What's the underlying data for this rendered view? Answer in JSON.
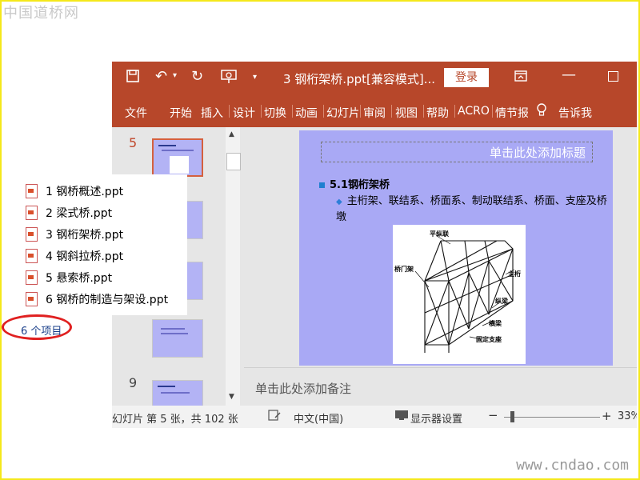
{
  "watermarks": {
    "top": "中国道桥网",
    "bottom": "www.cndao.com"
  },
  "window": {
    "title": "3 钢桁架桥.ppt[兼容模式]...",
    "login_label": "登录",
    "quick_access": {
      "save_icon": "save-icon",
      "undo_icon": "undo-icon",
      "redo_icon": "redo-icon",
      "present_icon": "present-icon",
      "customize_icon": "chevron-down-icon"
    },
    "controls": {
      "ribbon_options_icon": "ribbon-display-icon",
      "minimize": "—",
      "maximize_icon": "maximize-icon"
    }
  },
  "tabs": [
    "文件",
    "开始",
    "插入",
    "设计",
    "切换",
    "动画",
    "幻灯片",
    "审阅",
    "视图",
    "帮助",
    "ACRO",
    "情节报",
    "告诉我"
  ],
  "tell_me_icon": "lightbulb-icon",
  "thumbnails": {
    "labels": [
      "5",
      "9"
    ]
  },
  "slide": {
    "title_placeholder": "单击此处添加标题",
    "heading": "5.1钢桁架桥",
    "sub_bullet": "主桁架、联结系、桥面系、制动联结系、桥面、支座及桥墩",
    "diagram_labels": [
      "平纵联",
      "桥门架",
      "主桁",
      "纵梁",
      "横梁",
      "固定支座"
    ]
  },
  "notes_placeholder": "单击此处添加备注",
  "statusbar": {
    "slide_info": "幻灯片 第 5 张，共 102 张",
    "language": "中文(中国)",
    "display_settings": "显示器设置",
    "zoom_minus": "−",
    "zoom_plus": "+",
    "zoom": "33%"
  },
  "explorer_popup": {
    "files": [
      "1 钢桥概述.ppt",
      "2 梁式桥.ppt",
      "3 钢桁架桥.ppt",
      "4 钢斜拉桥.ppt",
      "5 悬索桥.ppt",
      "6 钢桥的制造与架设.ppt"
    ],
    "item_count": "6 个项目"
  },
  "colors": {
    "accent": "#b7472a",
    "slide_bg": "#a9a9f5",
    "highlight": "#e02020"
  }
}
